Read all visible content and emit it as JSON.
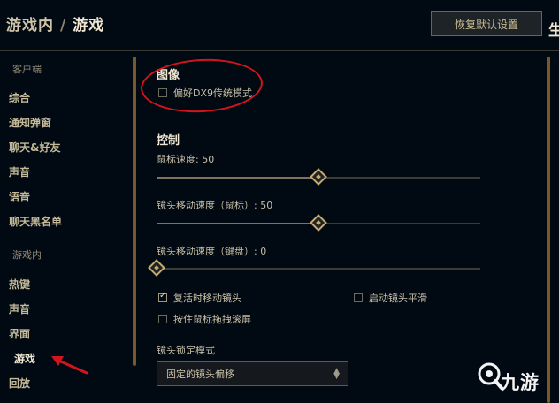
{
  "header": {
    "breadcrumb_parent": "游戏内",
    "breadcrumb_sep": "/",
    "breadcrumb_current": "游戏",
    "reset_button": "恢复默认设置",
    "corner_text": "生"
  },
  "sidebar": {
    "client_section": "客户端",
    "client_items": [
      "综合",
      "通知弹窗",
      "聊天&好友",
      "声音",
      "语音",
      "聊天黑名单"
    ],
    "ingame_section": "游戏内",
    "ingame_items": [
      "热键",
      "声音",
      "界面",
      "游戏",
      "回放"
    ],
    "active_item": "游戏"
  },
  "graphics": {
    "title": "图像",
    "dx9_label": "偏好DX9传统模式",
    "dx9_checked": false
  },
  "controls": {
    "title": "控制",
    "mouse_speed_label": "鼠标速度: 50",
    "mouse_speed_value": 50,
    "cam_speed_mouse_label": "镜头移动速度（鼠标）: 50",
    "cam_speed_mouse_value": 50,
    "cam_speed_keyboard_label": "镜头移动速度（键盘）: 0",
    "cam_speed_keyboard_value": 0,
    "move_camera_on_revive": "复活时移动镜头",
    "move_camera_on_revive_checked": true,
    "smooth_camera": "启动镜头平滑",
    "smooth_camera_checked": false,
    "drag_scroll": "按住鼠标拖拽滚屏",
    "drag_scroll_checked": false,
    "camera_lock_label": "镜头锁定模式",
    "camera_lock_value": "固定的镜头偏移"
  },
  "watermark": {
    "text": "九游"
  },
  "colors": {
    "background": "#010a13",
    "gold": "#c8aa6e",
    "annotation_red": "#d4141c"
  }
}
